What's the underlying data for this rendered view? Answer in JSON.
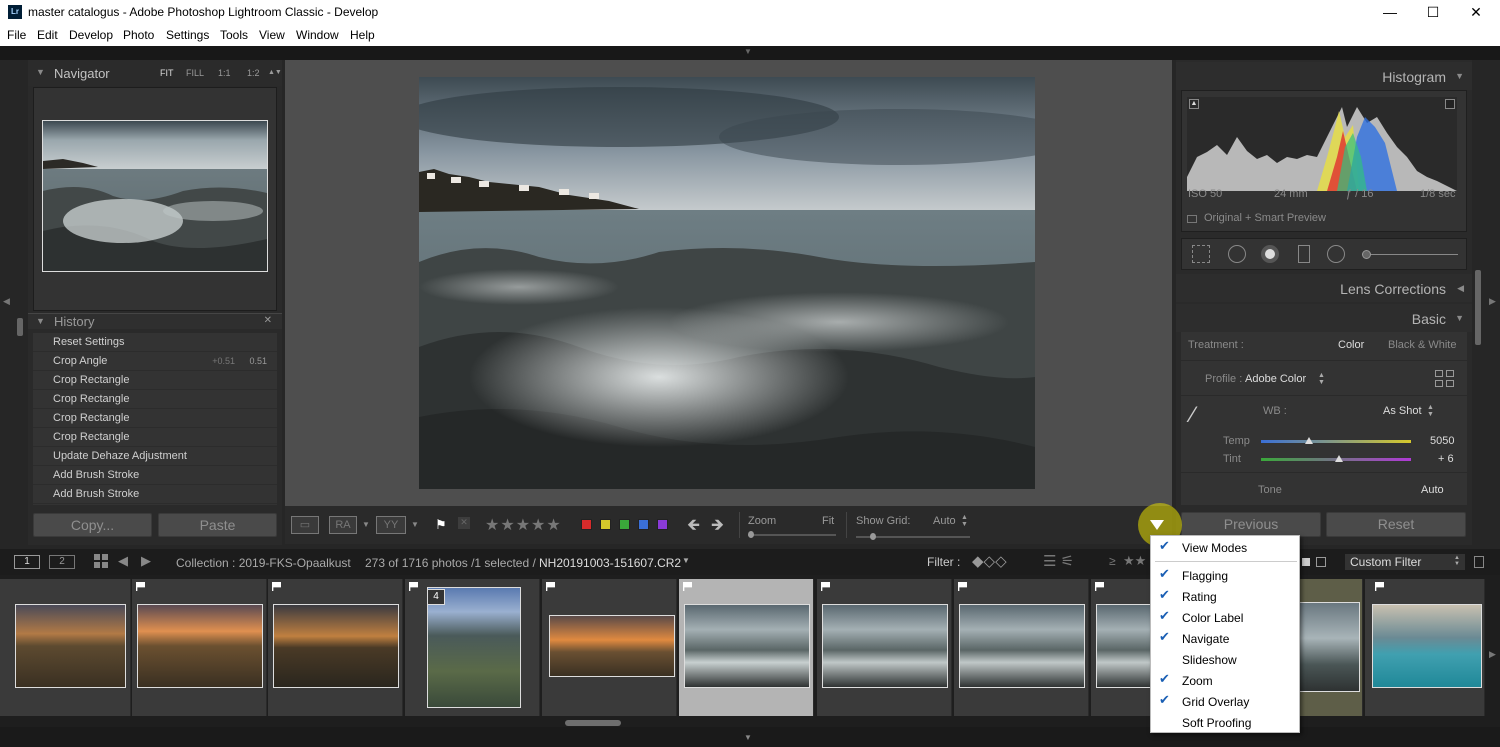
{
  "window": {
    "title": "master catalogus - Adobe Photoshop Lightroom Classic - Develop",
    "logo": "Lr",
    "minimize_icon": "—",
    "maximize_icon": "☐",
    "close_icon": "✕"
  },
  "menubar": [
    "File",
    "Edit",
    "Develop",
    "Photo",
    "Settings",
    "Tools",
    "View",
    "Window",
    "Help"
  ],
  "navigator": {
    "title": "Navigator",
    "zoom_options": [
      "FIT",
      "FILL",
      "1:1",
      "1:2"
    ]
  },
  "history": {
    "title": "History",
    "items": [
      {
        "label": "Reset Settings",
        "v1": "",
        "v2": ""
      },
      {
        "label": "Crop Angle",
        "v1": "+0.51",
        "v2": "0.51"
      },
      {
        "label": "Crop Rectangle",
        "v1": "",
        "v2": ""
      },
      {
        "label": "Crop Rectangle",
        "v1": "",
        "v2": ""
      },
      {
        "label": "Crop Rectangle",
        "v1": "",
        "v2": ""
      },
      {
        "label": "Crop Rectangle",
        "v1": "",
        "v2": ""
      },
      {
        "label": "Update Dehaze Adjustment",
        "v1": "",
        "v2": ""
      },
      {
        "label": "Add Brush Stroke",
        "v1": "",
        "v2": ""
      },
      {
        "label": "Add Brush Stroke",
        "v1": "",
        "v2": ""
      }
    ]
  },
  "left_buttons": {
    "copy": "Copy...",
    "paste": "Paste"
  },
  "toolbar": {
    "ra_label": "RA",
    "yy_label": "YY",
    "stars": "★★★★★",
    "zoom_label": "Zoom",
    "zoom_value": "Fit",
    "grid_label": "Show Grid:",
    "grid_value": "Auto",
    "colors": [
      "#d62b2b",
      "#d6c92b",
      "#3aa83a",
      "#3a6fd6",
      "#8a3ad6"
    ]
  },
  "histogram": {
    "title": "Histogram",
    "iso": "ISO 50",
    "focal": "24 mm",
    "aperture": "ƒ / 16",
    "shutter": "1/8 sec",
    "preview": "Original + Smart Preview"
  },
  "panels": {
    "lens": "Lens Corrections",
    "basic": "Basic"
  },
  "basic": {
    "treatment_label": "Treatment :",
    "color": "Color",
    "bw": "Black & White",
    "profile_label": "Profile :",
    "profile_value": "Adobe Color",
    "wb_label": "WB :",
    "wb_value": "As Shot",
    "temp_label": "Temp",
    "temp_value": "5050",
    "temp_pos": 0.32,
    "tint_label": "Tint",
    "tint_value": "+ 6",
    "tint_pos": 0.52,
    "tone_label": "Tone",
    "tone_value": "Auto"
  },
  "right_buttons": {
    "previous": "Previous",
    "reset": "Reset"
  },
  "filterbar": {
    "page1": "1",
    "page2": "2",
    "collection": "Collection : 2019-FKS-Opaalkust",
    "count": "273 of 1716 photos /1 selected /",
    "filename": "NH20191003-151607.CR2",
    "filter_label": "Filter :",
    "custom_filter": "Custom Filter",
    "gte": "≥"
  },
  "filmstrip": {
    "badge": "4"
  },
  "context_menu": [
    {
      "label": "View Modes",
      "checked": true
    },
    {
      "label": "Flagging",
      "checked": true
    },
    {
      "label": "Rating",
      "checked": true
    },
    {
      "label": "Color Label",
      "checked": true
    },
    {
      "label": "Navigate",
      "checked": true
    },
    {
      "label": "Slideshow",
      "checked": false
    },
    {
      "label": "Zoom",
      "checked": true
    },
    {
      "label": "Grid Overlay",
      "checked": true
    },
    {
      "label": "Soft Proofing",
      "checked": false
    }
  ]
}
